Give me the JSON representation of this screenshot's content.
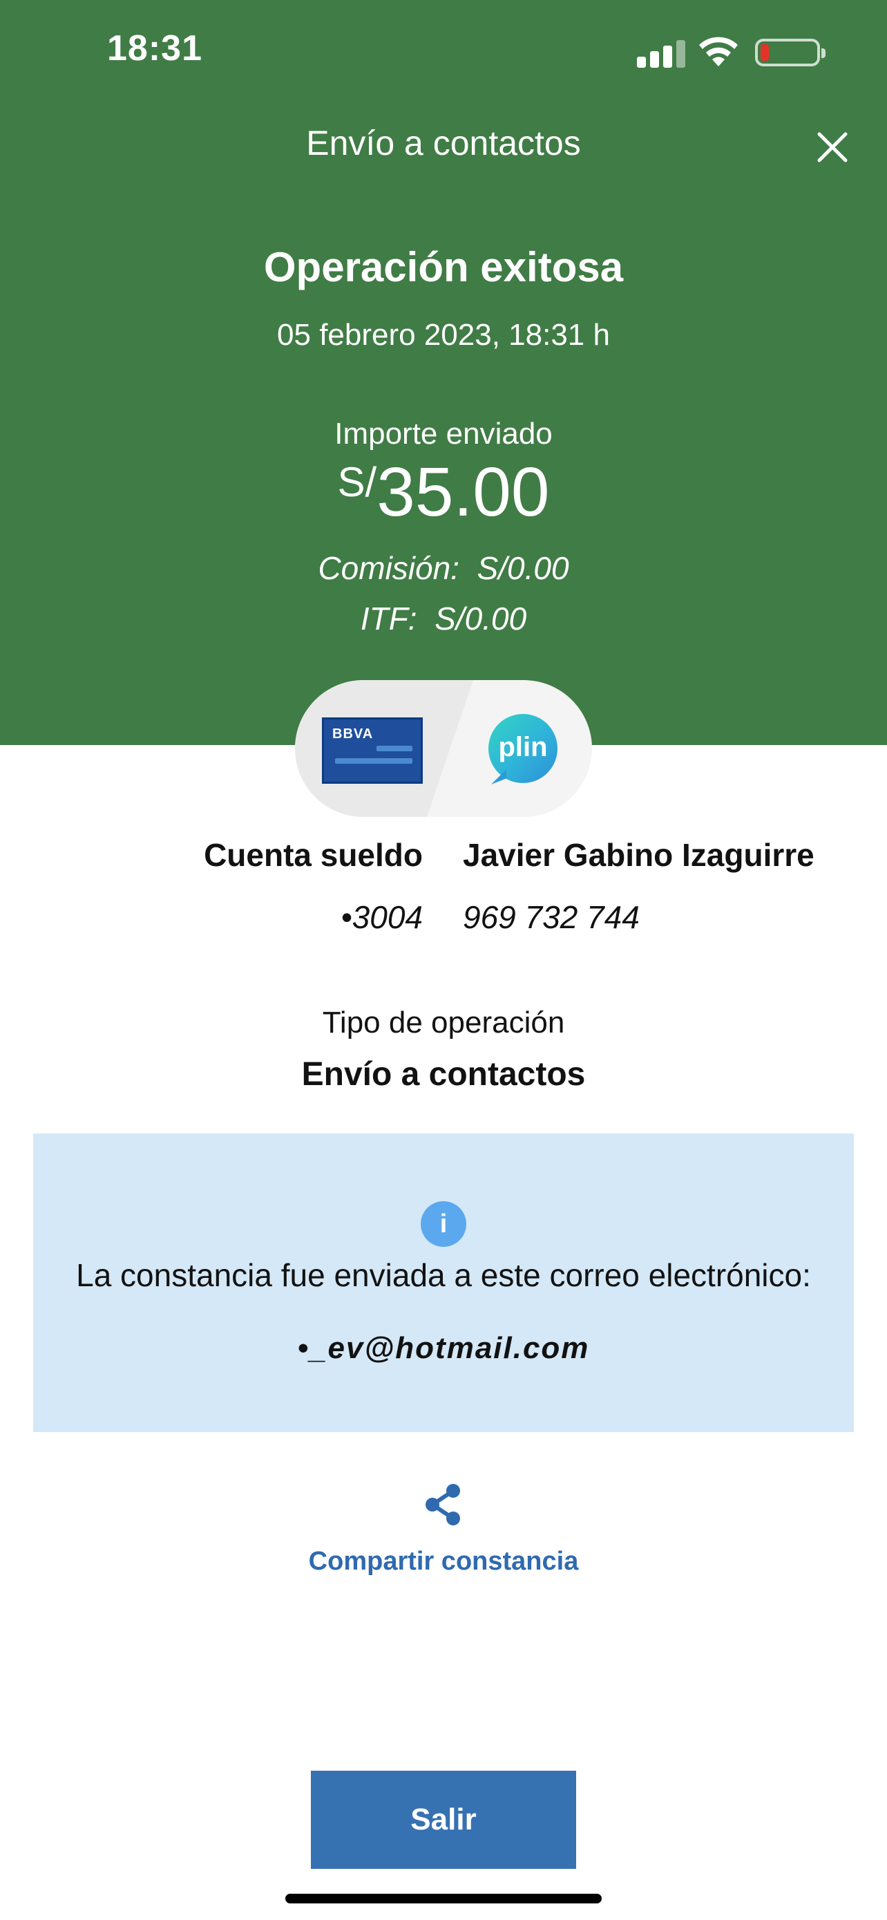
{
  "status_bar": {
    "time": "18:31",
    "battery_color": "#E5332A"
  },
  "header": {
    "title": "Envío a contactos",
    "background": "#407C45",
    "close_icon": "close-icon"
  },
  "result": {
    "title": "Operación exitosa",
    "datetime": "05 febrero 2023, 18:31 h",
    "amount_label": "Importe enviado",
    "currency": "S/",
    "amount": "35.00",
    "commission_label": "Comisión:",
    "commission_value": "S/0.00",
    "itf_label": "ITF:",
    "itf_value": "S/0.00"
  },
  "transfer": {
    "source_brand": "BBVA",
    "destination_brand": "plin",
    "source_account": "Cuenta sueldo",
    "source_number": "•3004",
    "recipient_name": "Javier Gabino Izaguirre",
    "recipient_phone": "969 732 744"
  },
  "operation": {
    "label": "Tipo de operación",
    "value": "Envío a contactos"
  },
  "notice": {
    "icon": "info-icon",
    "text": "La constancia fue enviada a este correo electrónico:",
    "email": "•_ev@hotmail.com",
    "background": "#D4E8F7"
  },
  "actions": {
    "share_icon": "share-icon",
    "share_label": "Compartir constancia",
    "exit_label": "Salir",
    "accent": "#3671B2"
  }
}
